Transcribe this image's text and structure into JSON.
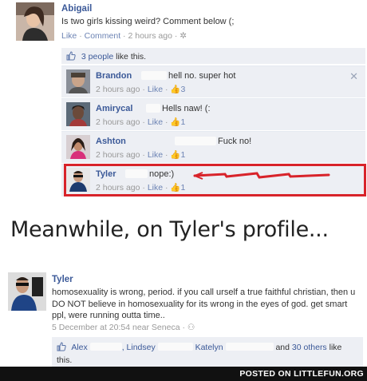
{
  "post": {
    "author": "Abigail",
    "text": "Is two girls kissing weird? Comment below (;",
    "actions": {
      "like": "Like",
      "comment": "Comment"
    },
    "time": "2 hours ago",
    "likes_count_text": "3 people",
    "likes_suffix": "like this."
  },
  "comments": [
    {
      "name": "Brandon",
      "text": "hell no. super hot",
      "time": "2 hours ago",
      "like": "Like",
      "likes": "3"
    },
    {
      "name": "Amirycal",
      "text": "Hells naw! (:",
      "time": "2 hours ago",
      "like": "Like",
      "likes": "1"
    },
    {
      "name": "Ashton",
      "text": "Fuck no!",
      "time": "2 hours ago",
      "like": "Like",
      "likes": "1"
    },
    {
      "name": "Tyler",
      "text": "nope:)",
      "time": "2 hours ago",
      "like": "Like",
      "likes": "1"
    }
  ],
  "caption": "Meanwhile, on Tyler's profile...",
  "profile_post": {
    "author": "Tyler",
    "text": "homosexuality is wrong, period. if you call urself a true faithful christian, then u DO NOT believe in homosexuality for its wrong in the eyes of god. get smart ppl, were running outta time..",
    "date": "5 December at 20:54",
    "location": "near Seneca",
    "likers": {
      "first": "Alex",
      "second": ", Lindsey",
      "third": "Katelyn",
      "and": "and",
      "others": "30 others",
      "suffix": "like this."
    }
  },
  "footer": {
    "text": "POSTED ON LITTLEFUN.ORG"
  },
  "colors": {
    "link": "#3b5998",
    "highlight": "#d8232a",
    "comment_bg": "#edeff4"
  }
}
